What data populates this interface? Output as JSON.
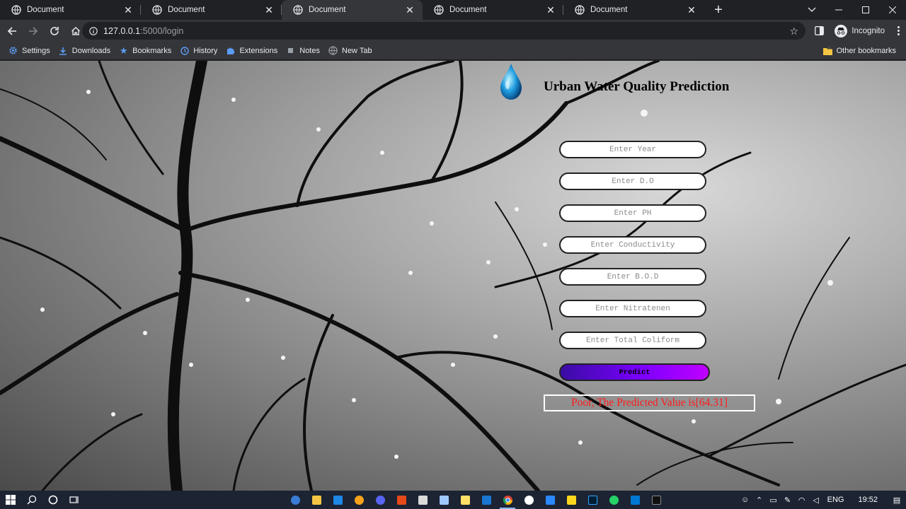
{
  "browser": {
    "tabs": [
      {
        "title": "Document",
        "active": false
      },
      {
        "title": "Document",
        "active": false
      },
      {
        "title": "Document",
        "active": true
      },
      {
        "title": "Document",
        "active": false
      },
      {
        "title": "Document",
        "active": false
      }
    ],
    "address": {
      "host": "127.0.0.1",
      "rest": ":5000/login"
    },
    "profile_label": "Incognito",
    "bookmarks": [
      {
        "label": "Settings",
        "icon": "gear-icon"
      },
      {
        "label": "Downloads",
        "icon": "download-icon"
      },
      {
        "label": "Bookmarks",
        "icon": "star-icon"
      },
      {
        "label": "History",
        "icon": "history-icon"
      },
      {
        "label": "Extensions",
        "icon": "puzzle-icon"
      },
      {
        "label": "Notes",
        "icon": "note-icon"
      },
      {
        "label": "New Tab",
        "icon": "globe-icon"
      }
    ],
    "other_bookmarks": "Other bookmarks"
  },
  "page": {
    "title": "Urban Water Quality Prediction",
    "fields": [
      {
        "placeholder": "Enter Year"
      },
      {
        "placeholder": "Enter D.O"
      },
      {
        "placeholder": "Enter PH"
      },
      {
        "placeholder": "Enter Conductivity"
      },
      {
        "placeholder": "Enter B.O.D"
      },
      {
        "placeholder": "Enter Nitratenen"
      },
      {
        "placeholder": "Enter Total Coliform"
      }
    ],
    "predict_label": "Predict",
    "result_text": "Poor, The Predicted Value is[64.31]",
    "colors": {
      "result": "#ff1a1a",
      "button_start": "#3a0ca3",
      "button_end": "#c000ff"
    }
  },
  "taskbar": {
    "language": "ENG",
    "time": "19:52"
  }
}
